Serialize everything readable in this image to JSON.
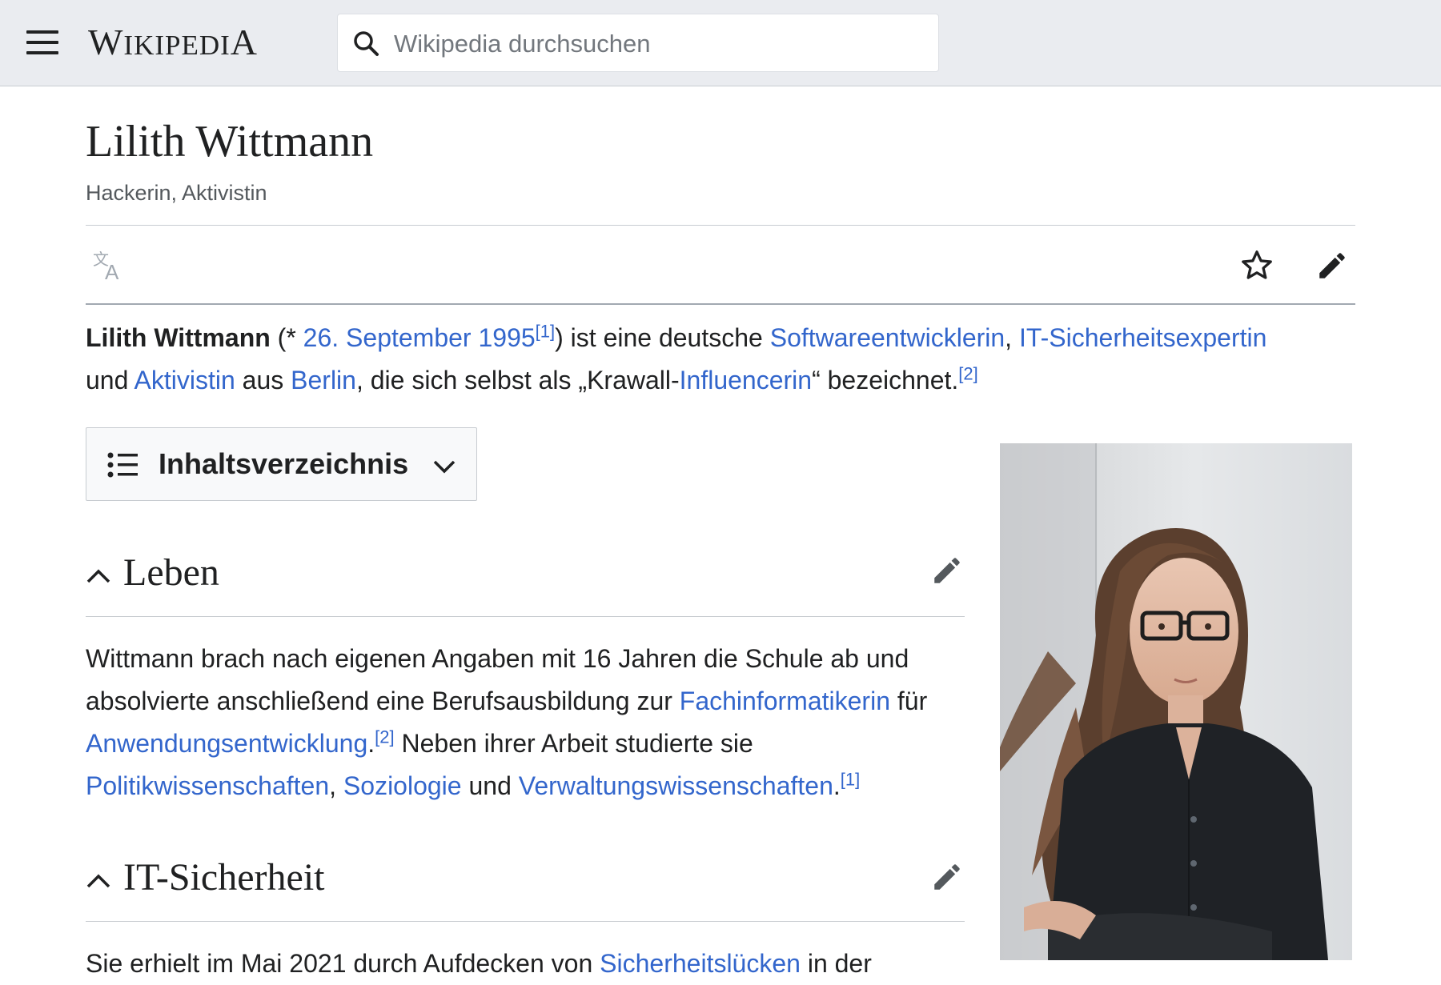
{
  "header": {
    "logo_text_cap1": "W",
    "logo_text_mid": "IKIPEDI",
    "logo_text_cap2": "A",
    "search_placeholder": "Wikipedia durchsuchen"
  },
  "article": {
    "title": "Lilith Wittmann",
    "subtitle": "Hackerin, Aktivistin",
    "intro": {
      "name": "Lilith Wittmann",
      "t1": " (* ",
      "link_birthdate": "26. September 1995",
      "ref1": "[1]",
      "t2": ") ist eine deutsche ",
      "link_software": "Softwareentwicklerin",
      "t3": ", ",
      "link_it": "IT-Sicherheitsexpertin",
      "t4": " und ",
      "link_aktivistin": "Aktivistin",
      "t5": " aus ",
      "link_berlin": "Berlin",
      "t6": ", die sich selbst als „Krawall-",
      "link_influencerin": "Influencerin",
      "t7": "“ bezeichnet.",
      "ref2": "[2]"
    },
    "toc_label": "Inhaltsverzeichnis",
    "sections": [
      {
        "heading": "Leben",
        "p": {
          "t1": "Wittmann brach nach eigenen Angaben mit 16 Jahren die Schule ab und absolvierte anschließend eine Berufsausbildung zur ",
          "link_fachinf": "Fachinformatikerin",
          "t2": " für ",
          "link_anwendung": "Anwendungsentwicklung",
          "t3": ".",
          "ref2": "[2]",
          "t4": " Neben ihrer Arbeit studierte sie ",
          "link_politik": "Politikwissenschaften",
          "t5": ", ",
          "link_soziologie": "Soziologie",
          "t6": " und ",
          "link_verwaltung": "Verwaltungswissenschaften",
          "t7": ".",
          "ref1": "[1]"
        }
      },
      {
        "heading": "IT-Sicherheit",
        "p": {
          "t1": "Sie erhielt im Mai 2021 durch Aufdecken von ",
          "link_luecken": "Sicherheitslücken",
          "t2": " in der"
        }
      }
    ]
  },
  "icons": {
    "menu": "hamburger-icon",
    "search": "search-icon",
    "language": "translate-icon",
    "watch": "star-icon",
    "edit": "pencil-icon",
    "toc": "list-icon",
    "toc_toggle": "chevron-down-icon",
    "section_toggle": "caret-up-icon"
  },
  "colors": {
    "link": "#3366cc",
    "header_bg": "#eaecf0",
    "text": "#202122",
    "muted": "#54595d"
  }
}
